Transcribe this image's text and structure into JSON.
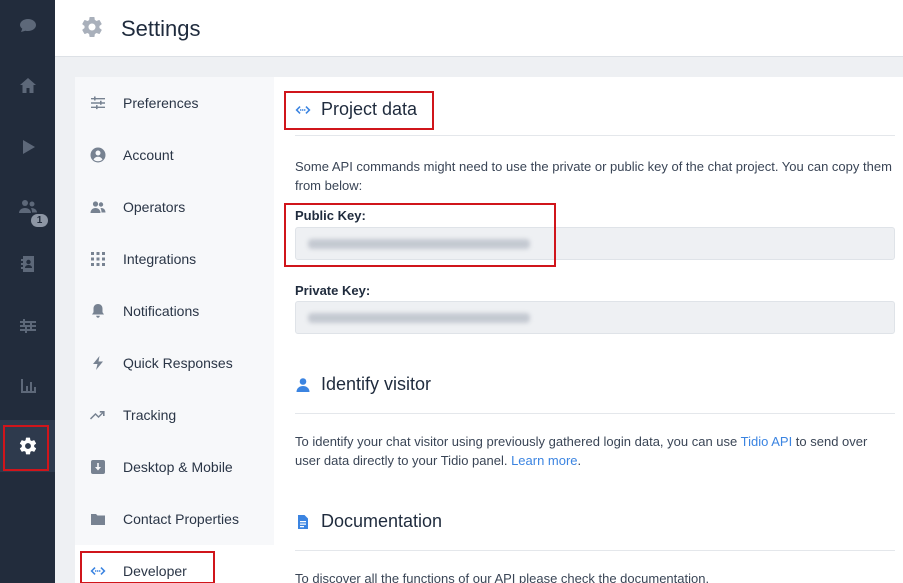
{
  "header": {
    "title": "Settings",
    "icon": "gear-icon"
  },
  "rail": {
    "items": [
      {
        "name": "chat-icon"
      },
      {
        "name": "home-icon"
      },
      {
        "name": "play-icon"
      },
      {
        "name": "visitors-icon",
        "badge": "1"
      },
      {
        "name": "contacts-icon"
      },
      {
        "name": "sliders-icon"
      },
      {
        "name": "analytics-icon"
      },
      {
        "name": "settings-gear-icon",
        "active": true
      }
    ]
  },
  "menu": {
    "items": [
      {
        "label": "Preferences",
        "icon": "preferences-icon"
      },
      {
        "label": "Account",
        "icon": "account-icon"
      },
      {
        "label": "Operators",
        "icon": "operators-icon"
      },
      {
        "label": "Integrations",
        "icon": "integrations-icon"
      },
      {
        "label": "Notifications",
        "icon": "bell-icon"
      },
      {
        "label": "Quick Responses",
        "icon": "lightning-icon"
      },
      {
        "label": "Tracking",
        "icon": "tracking-icon"
      },
      {
        "label": "Desktop & Mobile",
        "icon": "download-icon"
      },
      {
        "label": "Contact Properties",
        "icon": "folder-icon"
      },
      {
        "label": "Developer",
        "icon": "code-icon",
        "active": true
      }
    ]
  },
  "project_data": {
    "title": "Project data",
    "description": "Some API commands might need to use the private or public key of the chat project. You can copy them from below:",
    "public_key_label": "Public Key:",
    "private_key_label": "Private Key:"
  },
  "identify": {
    "title": "Identify visitor",
    "text_before": "To identify your chat visitor using previously gathered login data, you can use ",
    "link1": "Tidio API",
    "text_middle": " to send over user data directly to your Tidio panel. ",
    "link2": "Learn more",
    "text_after": "."
  },
  "documentation": {
    "title": "Documentation",
    "text": "To discover all the functions of our API please check the documentation."
  },
  "colors": {
    "accent": "#3b84e1",
    "rail": "#222c3c",
    "highlight": "#d0151b"
  }
}
